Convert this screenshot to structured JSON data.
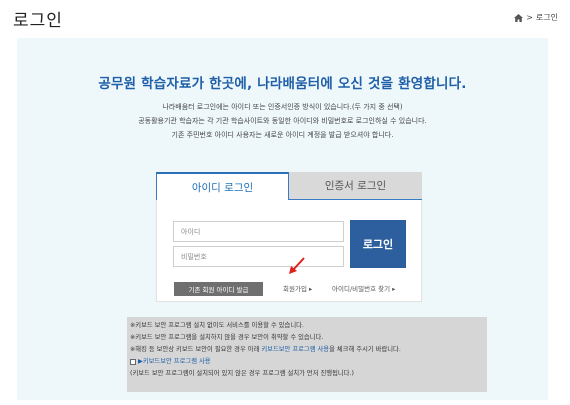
{
  "page": {
    "title": "로그인"
  },
  "breadcrumb": {
    "home_icon": "home-icon",
    "separator": ">",
    "current": "로그인"
  },
  "welcome": {
    "headline": "공무원 학습자료가 한곳에, 나라배움터에 오신 것을 환영합니다."
  },
  "info": {
    "line1": "나라배움터 로그인에는 아이디 또는 인증서인증 방식이 있습니다.(두 가지 중 선택)",
    "line2": "공동활용기관 학습자는 각 기관 학습사이트와 동일한 아이디와 비밀번호로 로그인하실 수 있습니다.",
    "line3": "기존 주민번호 아이디 사용자는 새로운 아이디 계정을 발급 받으셔야 합니다."
  },
  "tabs": [
    {
      "label": "아이디 로그인",
      "active": true
    },
    {
      "label": "인증서 로그인",
      "active": false
    }
  ],
  "form": {
    "id_placeholder": "아이디",
    "pw_placeholder": "비밀번호",
    "login_label": "로그인",
    "issue_label": "기존 회원 아이디 발급",
    "join_label": "회원가입",
    "find_label": "아이디/비밀번호 찾기",
    "link_arrow": "▸"
  },
  "notice": {
    "line1": "※키보드 보안 프로그램 설치 없이도 서비스를 이용할 수 있습니다.",
    "line2": "※키보드 보안 프로그램을 설치하지 않을 경우 보안이 취약할 수 있습니다.",
    "line3_pre": "※해킹 등 보안상 키보드 보안이 필요한 경우 아래 ",
    "line3_link": "키보드보안 프로그램 사용",
    "line3_post": "을 체크해 주시기 바랍니다.",
    "checkbox_label": "▶키보드보안 프로그램 사용",
    "line5_pre": "(키보드 보안 프로그램이 ",
    "line5_mid": "설치되어 있지 않은 경우",
    "line5_post": " 프로그램 설치가 먼저 진행됩니다.)"
  },
  "colors": {
    "accent": "#1f5fa8",
    "panel_bg": "#eef8fb",
    "login_button": "#2d5f9e",
    "annotation_arrow": "#e0201c"
  }
}
